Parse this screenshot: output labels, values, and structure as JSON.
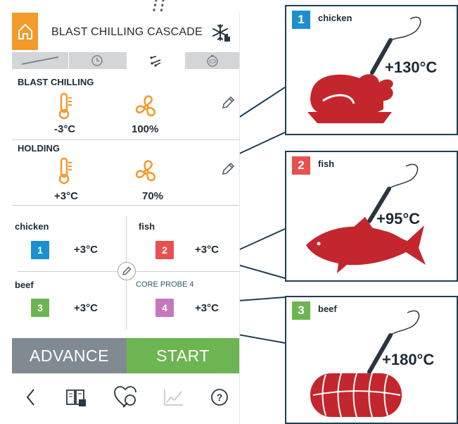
{
  "colors": {
    "orange": "#f39a2a",
    "blue": "#1c8fd0",
    "red": "#e9504f",
    "green": "#6db552",
    "purple": "#c678bd",
    "grey_button": "#818a91",
    "meat": "#c4262e",
    "line": "#1f3f55"
  },
  "header": {
    "title": "BLAST CHILLING CASCADE",
    "home_icon": "home-icon",
    "snow_icon": "snowflake-hand-icon"
  },
  "tabs": [
    {
      "icon": "probe-icon"
    },
    {
      "icon": "clock-icon"
    },
    {
      "icon": "probe-multi-icon",
      "active": true
    },
    {
      "icon": "timer-icon"
    }
  ],
  "blast_chilling": {
    "label": "BLAST CHILLING",
    "temperature": "-3°C",
    "fan": "100%"
  },
  "holding": {
    "label": "HOLDING",
    "temperature": "+3°C",
    "fan": "70%"
  },
  "probes": [
    {
      "label": "chicken",
      "number": "1",
      "temp": "+3°C",
      "color": "#1c8fd0"
    },
    {
      "label": "fish",
      "number": "2",
      "temp": "+3°C",
      "color": "#e9504f"
    },
    {
      "label": "beef",
      "number": "3",
      "temp": "+3°C",
      "color": "#6db552"
    },
    {
      "label": "CORE PROBE 4",
      "number": "4",
      "temp": "+3°C",
      "color": "#c678bd"
    }
  ],
  "buttons": {
    "advance": "ADVANCE",
    "start": "START"
  },
  "bottom_bar": [
    {
      "icon": "back-chevron-icon"
    },
    {
      "icon": "recipe-book-icon"
    },
    {
      "icon": "favorite-recipe-icon"
    },
    {
      "icon": "chart-icon"
    },
    {
      "icon": "help-icon"
    }
  ],
  "callouts": [
    {
      "number": "1",
      "name": "chicken",
      "temp": "+130°C",
      "color": "#1c8fd0"
    },
    {
      "number": "2",
      "name": "fish",
      "temp": "+95°C",
      "color": "#e9504f"
    },
    {
      "number": "3",
      "name": "beef",
      "temp": "+180°C",
      "color": "#6db552"
    }
  ]
}
